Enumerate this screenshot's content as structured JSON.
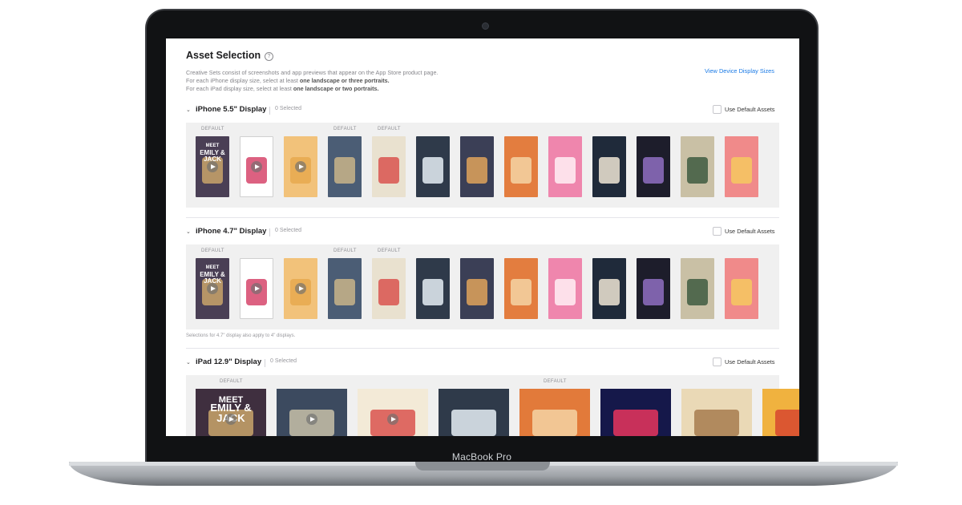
{
  "device": {
    "brand": "MacBook Pro"
  },
  "page": {
    "title": "Asset Selection",
    "help_glyph": "?",
    "description": [
      {
        "text": "Creative Sets consist of screenshots and app previews that appear on the App Store product page.",
        "bold": ""
      },
      {
        "text": "For each iPhone display size, select at least ",
        "bold": "one landscape or three portraits."
      },
      {
        "text": "For each iPad display size, select at least ",
        "bold": "one landscape or two portraits."
      }
    ],
    "view_sizes_link": "View Device Display Sizes"
  },
  "sections": [
    {
      "title": "iPhone 5.5\" Display",
      "selected": "0 Selected",
      "default_assets_label": "Use Default Assets",
      "default_tag": "DEFAULT"
    },
    {
      "title": "iPhone 4.7\" Display",
      "selected": "0 Selected",
      "default_assets_label": "Use Default Assets",
      "default_tag": "DEFAULT",
      "note": "Selections for 4.7\" display also apply to 4\" displays."
    },
    {
      "title": "iPad 12.9\" Display",
      "selected": "0 Selected",
      "default_assets_label": "Use Default Assets",
      "default_tag": "DEFAULT"
    }
  ],
  "artwork_text": {
    "cover_meet": "MEET",
    "cover_name": "EMILY & JACK"
  },
  "colors": {
    "accent": "#1a7ae6",
    "tray": "#f0f0f0"
  },
  "phone_thumbs": [
    {
      "bg": "#4a3f55",
      "accent": "#c9a56b",
      "video": true,
      "default": true,
      "cover": true
    },
    {
      "bg": "#ffffff",
      "accent": "#d6456b",
      "video": true,
      "default": false,
      "dots": true
    },
    {
      "bg": "#f2c27a",
      "accent": "#e8a94f",
      "video": true,
      "default": false
    },
    {
      "bg": "#4b5d75",
      "accent": "#c9b48a",
      "video": false,
      "default": true
    },
    {
      "bg": "#e9e1cf",
      "accent": "#d9534f",
      "video": false,
      "default": true
    },
    {
      "bg": "#2f3a4a",
      "accent": "#e5eef5",
      "video": false,
      "default": false
    },
    {
      "bg": "#3b3f56",
      "accent": "#e0a35b",
      "video": false,
      "default": false
    },
    {
      "bg": "#e37d3f",
      "accent": "#f4d4a4",
      "video": false,
      "default": false
    },
    {
      "bg": "#ef86ad",
      "accent": "#fff0f5",
      "video": false,
      "default": false
    },
    {
      "bg": "#1f2a3a",
      "accent": "#f0e6d6",
      "video": false,
      "default": false
    },
    {
      "bg": "#1d1d2b",
      "accent": "#8f6fc2",
      "video": false,
      "default": false
    },
    {
      "bg": "#c9c0a5",
      "accent": "#3e5a3f",
      "video": false,
      "default": false
    },
    {
      "bg": "#f08a8a",
      "accent": "#f6c85f",
      "video": false,
      "default": false
    }
  ],
  "ipad_thumbs": [
    {
      "bg": "#3f2f3f",
      "accent": "#c9a56b",
      "video": true,
      "default": true,
      "cover": true
    },
    {
      "bg": "#3c4a5f",
      "accent": "#c7bfa8",
      "video": true,
      "default": false
    },
    {
      "bg": "#f3ead7",
      "accent": "#d9534f",
      "video": true,
      "default": false
    },
    {
      "bg": "#2f3a4a",
      "accent": "#e5eef5",
      "video": false,
      "default": false
    },
    {
      "bg": "#e27a3a",
      "accent": "#f4d4a4",
      "video": false,
      "default": true
    },
    {
      "bg": "#15184a",
      "accent": "#e8355d",
      "video": false,
      "default": false
    },
    {
      "bg": "#ead9b6",
      "accent": "#a77b4f",
      "video": false,
      "default": false
    },
    {
      "bg": "#f0b23f",
      "accent": "#d7472f",
      "video": false,
      "default": false
    },
    {
      "bg": "#f28fb2",
      "accent": "#ffffff",
      "video": false,
      "default": false
    }
  ]
}
